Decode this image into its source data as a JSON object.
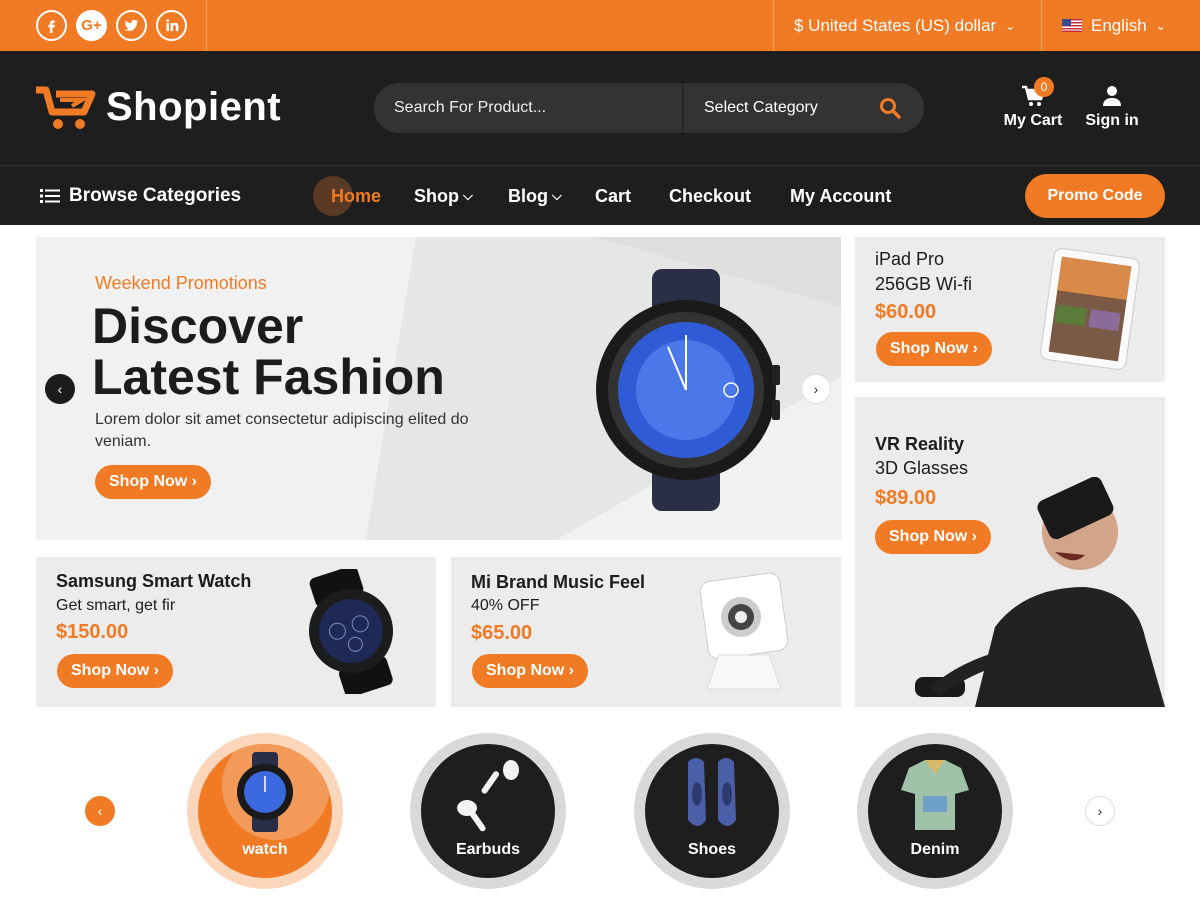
{
  "topbar": {
    "social": [
      "facebook-icon",
      "google-plus-icon",
      "twitter-icon",
      "linkedin-icon"
    ],
    "currency": "$ United States (US) dollar",
    "language": "English"
  },
  "header": {
    "logo": "Shopient",
    "search_placeholder": "Search For Product...",
    "category": "Select Category",
    "cart_label": "My Cart",
    "cart_count": "0",
    "signin_label": "Sign in"
  },
  "nav": {
    "browse": "Browse Categories",
    "items": [
      {
        "label": "Home",
        "active": true
      },
      {
        "label": "Shop",
        "dropdown": true
      },
      {
        "label": "Blog",
        "dropdown": true
      },
      {
        "label": "Cart"
      },
      {
        "label": "Checkout"
      },
      {
        "label": "My Account"
      }
    ],
    "promo": "Promo Code"
  },
  "hero": {
    "kicker": "Weekend Promotions",
    "title_line1": "Discover",
    "title_line2": "Latest Fashion",
    "desc": "Lorem dolor sit amet consectetur adipiscing elited do veniam.",
    "button": "Shop Now"
  },
  "cards": {
    "ipad": {
      "line1": "iPad Pro",
      "line2": "256GB Wi-fi",
      "price": "$60.00",
      "button": "Shop Now"
    },
    "vr": {
      "line1": "VR Reality",
      "line2": "3D Glasses",
      "price": "$89.00",
      "button": "Shop Now"
    },
    "samsung": {
      "line1": "Samsung Smart Watch",
      "line2": "Get smart, get fir",
      "price": "$150.00",
      "button": "Shop Now"
    },
    "mi": {
      "line1": "Mi Brand Music Feel",
      "line2": "40% OFF",
      "price": "$65.00",
      "button": "Shop Now"
    }
  },
  "categories": [
    {
      "label": "watch",
      "active": true
    },
    {
      "label": "Earbuds"
    },
    {
      "label": "Shoes"
    },
    {
      "label": "Denim"
    }
  ],
  "colors": {
    "accent": "#f07b24",
    "dark": "#1e1e1e"
  }
}
